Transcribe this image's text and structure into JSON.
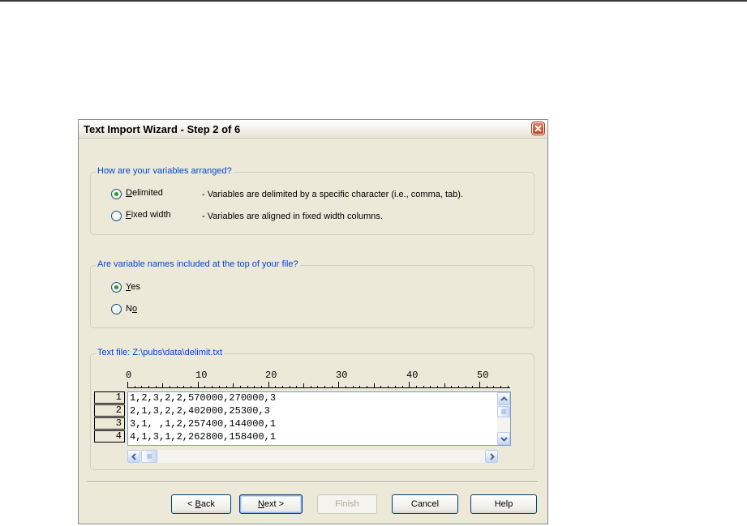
{
  "dialog": {
    "title": "Text Import Wizard - Step 2 of 6"
  },
  "arrangement": {
    "group_label": "How are your variables arranged?",
    "options": [
      {
        "label_mnemonic": "D",
        "label_rest": "elimited",
        "description": "- Variables are delimited by a specific character (i.e., comma, tab).",
        "checked": true
      },
      {
        "label_mnemonic": "F",
        "label_rest": "ixed width",
        "description": "- Variables are aligned in fixed width columns.",
        "checked": false
      }
    ]
  },
  "names_included": {
    "group_label": "Are variable names included at the top of your file?",
    "options": [
      {
        "label_mnemonic": "Y",
        "label_rest": "es",
        "label_prefix": "",
        "checked": true
      },
      {
        "label_prefix": "N",
        "label_mnemonic": "o",
        "label_rest": "",
        "checked": false
      }
    ]
  },
  "preview": {
    "group_label": "Text file: Z:\\pubs\\data\\delimit.txt",
    "ruler_labels": [
      "0",
      "10",
      "20",
      "30",
      "40",
      "50"
    ],
    "line_numbers": [
      "1",
      "2",
      "3",
      "4"
    ],
    "lines": [
      "1,2,3,2,2,570000,270000,3",
      "2,1,3,2,2,402000,25300,3",
      "3,1, ,1,2,257400,144000,1",
      "4,1,3,1,2,262800,158400,1"
    ]
  },
  "buttons": {
    "back_mnemonic": "B",
    "back_prefix": "< ",
    "back_rest": "ack",
    "next_mnemonic": "N",
    "next_rest": "ext >",
    "finish": "Finish",
    "cancel": "Cancel",
    "help": "Help"
  },
  "colors": {
    "dialog_bg": "#ECE9D8",
    "group_label": "#0046d5",
    "radio_dot": "#21a121"
  }
}
